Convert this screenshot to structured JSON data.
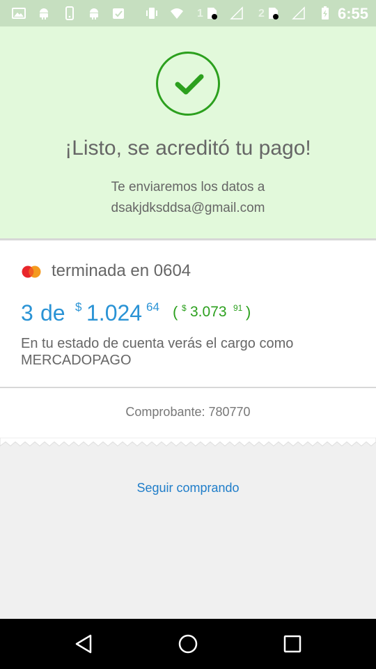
{
  "colors": {
    "status_bar_bg": "#c6dfc0",
    "success_bg": "#e2f9db",
    "success_green": "#2ca01e",
    "installment_blue": "#2a93d5",
    "link_blue": "#1f7dc9",
    "text_gray": "#666666",
    "page_bg": "#f0f0f0"
  },
  "status_bar": {
    "icons": [
      "image-icon",
      "android-icon",
      "phone-icon",
      "android-icon",
      "clipboard-check-icon",
      "vibrate-icon",
      "wifi-icon",
      "sim-card-icon",
      "signal-icon",
      "sim-card-icon",
      "signal-icon",
      "battery-charging-icon"
    ],
    "sim1_label": "1",
    "sim2_label": "2",
    "time": "6:55"
  },
  "success": {
    "icon": "check-icon",
    "title": "¡Listo, se acreditó tu pago!",
    "line1": "Te enviaremos los datos a",
    "email": "dsakjdksddsa@gmail.com"
  },
  "payment": {
    "card_brand_icon": "mastercard-icon",
    "card_label": "terminada en 0604",
    "installments_count": "3",
    "installments_de": "de",
    "currency_symbol": "$",
    "installment_amount": "1.024",
    "installment_cents": "64",
    "total_open": "(",
    "total_currency": "$",
    "total_amount": "3.073",
    "total_cents": "91",
    "total_close": ")",
    "statement_line1": "En tu estado de cuenta verás el cargo como",
    "statement_line2": "MERCADOPAGO"
  },
  "receipt": {
    "label": "Comprobante: 780770"
  },
  "cta": {
    "label": "Seguir comprando"
  },
  "nav_bar": {
    "back": "back-icon",
    "home": "home-icon",
    "recents": "recents-icon"
  }
}
